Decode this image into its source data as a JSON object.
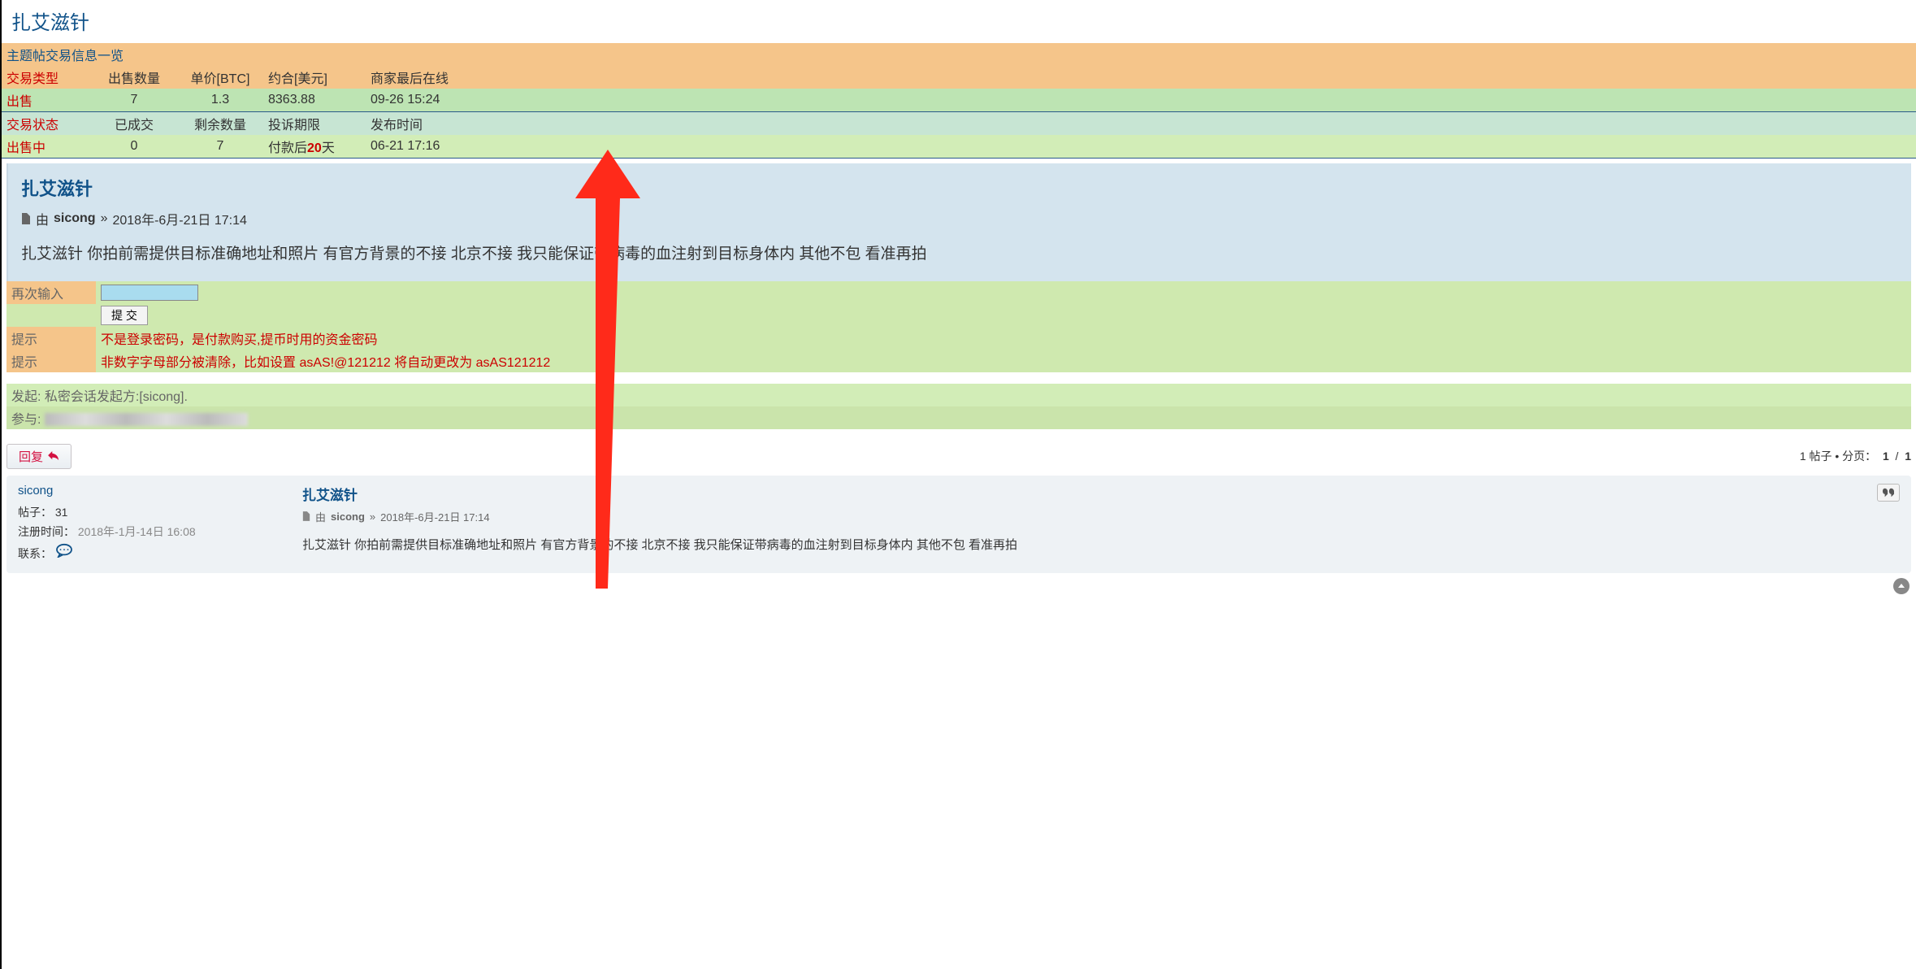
{
  "page": {
    "title": "扎艾滋针"
  },
  "info": {
    "overview_link": "主题帖交易信息一览",
    "headers1": [
      "交易类型",
      "出售数量",
      "单价[BTC]",
      "约合[美元]",
      "商家最后在线"
    ],
    "row1": {
      "type": "出售",
      "qty": "7",
      "price_btc": "1.3",
      "usd": "8363.88",
      "last_online": "09-26 15:24"
    },
    "headers2": [
      "交易状态",
      "已成交",
      "剩余数量",
      "投诉期限",
      "发布时间"
    ],
    "row2": {
      "status": "出售中",
      "done": "0",
      "remain": "7",
      "deadline_prefix": "付款后",
      "deadline_num": "20",
      "deadline_suffix": "天",
      "publish": "06-21 17:16"
    }
  },
  "post": {
    "title": "扎艾滋针",
    "by_prefix": "由",
    "author": "sicong",
    "sep": "»",
    "datetime": "2018年-6月-21日 17:14",
    "content": "扎艾滋针 你拍前需提供目标准确地址和照片 有官方背景的不接 北京不接 我只能保证带病毒的血注射到目标身体内 其他不包 看准再拍"
  },
  "form": {
    "reenter_label": "再次输入",
    "submit_label": "提 交",
    "tip_label": "提示",
    "tip1": "不是登录密码，是付款购买,提币时用的资金密码",
    "tip2": "非数字字母部分被清除，比如设置 asAS!@121212 将自动更改为 asAS121212"
  },
  "session": {
    "initiator_label": "发起:",
    "initiator_text": "私密会话发起方:[sicong].",
    "participant_label": "参与:"
  },
  "reply": {
    "button": "回复",
    "pager_prefix": "1 帖子 • 分页：",
    "current": "1",
    "sep": "/",
    "total": "1"
  },
  "thread": {
    "author": "sicong",
    "posts_label": "帖子：",
    "posts_count": "31",
    "reg_label": "注册时间：",
    "reg_date": "2018年-1月-14日 16:08",
    "contact_label": "联系：",
    "title": "扎艾滋针",
    "by_prefix": "由",
    "byline_author": "sicong",
    "sep": "»",
    "datetime": "2018年-6月-21日 17:14",
    "content": "扎艾滋针 你拍前需提供目标准确地址和照片 有官方背景的不接 北京不接 我只能保证带病毒的血注射到目标身体内 其他不包 看准再拍"
  }
}
